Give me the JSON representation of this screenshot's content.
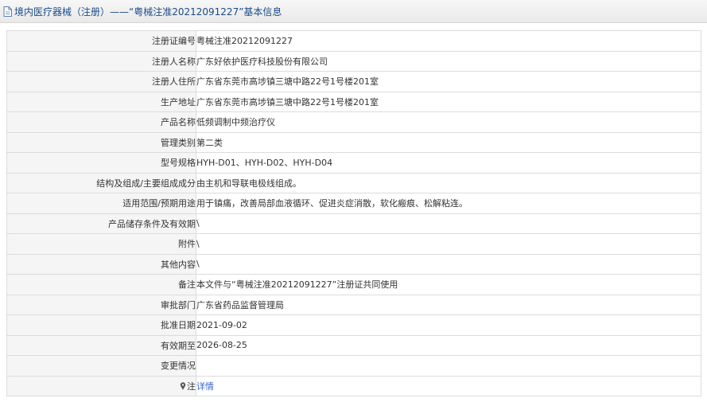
{
  "header": {
    "title": "境内医疗器械（注册）——“粤械注准20212091227”基本信息",
    "icon": "document-icon"
  },
  "rows": [
    {
      "label": "注册证编号",
      "value": "粤械注准20212091227"
    },
    {
      "label": "注册人名称",
      "value": "广东好依护医疗科技股份有限公司"
    },
    {
      "label": "注册人住所",
      "value": "广东省东莞市高埗镇三塘中路22号1号楼201室"
    },
    {
      "label": "生产地址",
      "value": "广东省东莞市高埗镇三塘中路22号1号楼201室"
    },
    {
      "label": "产品名称",
      "value": "低频调制中频治疗仪"
    },
    {
      "label": "管理类别",
      "value": "第二类"
    },
    {
      "label": "型号规格",
      "value": "HYH-D01、HYH-D02、HYH-D04"
    },
    {
      "label": "结构及组成/主要组成成分",
      "value": "由主机和导联电极线组成。"
    },
    {
      "label": "适用范围/预期用途",
      "value": "用于镇痛，改善局部血液循环、促进炎症消散，软化瘢痕、松解粘连。"
    },
    {
      "label": "产品储存条件及有效期",
      "value": "\\"
    },
    {
      "label": "附件",
      "value": "\\"
    },
    {
      "label": "其他内容",
      "value": "\\"
    },
    {
      "label": "备注",
      "value": "本文件与“粤械注准20212091227”注册证共同使用"
    },
    {
      "label": "审批部门",
      "value": "广东省药品监督管理局"
    },
    {
      "label": "批准日期",
      "value": "2021-09-02"
    },
    {
      "label": "有效期至",
      "value": "2026-08-25"
    },
    {
      "label": "变更情况",
      "value": ""
    }
  ],
  "note": {
    "label": "注",
    "icon": "pin-icon",
    "link_text": "详情",
    "link_color": "#3366cc"
  }
}
